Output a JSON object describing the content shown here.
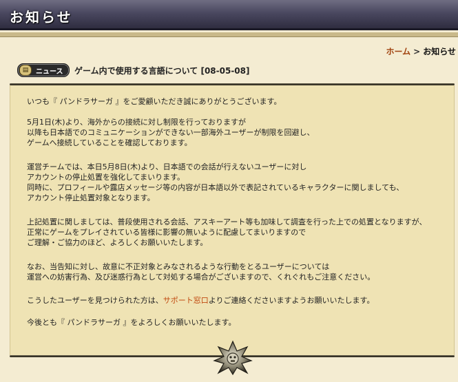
{
  "header": {
    "title": "お知らせ"
  },
  "breadcrumb": {
    "home": "ホーム",
    "separator": ">",
    "current": "お知らせ"
  },
  "news": {
    "badge": "ニュース",
    "title": "ゲーム内で使用する言語について [08-05-08]"
  },
  "body": {
    "p1": "いつも『 パンドラサーガ 』をご愛顧いただき誠にありがとうございます。",
    "p2": "5月1日(木)より、海外からの接続に対し制限を行っておりますが\n以降も日本語でのコミュニケーションができない一部海外ユーザーが制限を回避し、\nゲームへ接続していることを確認しております。",
    "p3": "運営チームでは、本日5月8日(木)より、日本語での会話が行えないユーザーに対し\nアカウントの停止処置を強化してまいります。\n同時に、プロフィールや露店メッセージ等の内容が日本語以外で表記されているキャラクターに関しましても、\nアカウント停止処置対象となります。",
    "p4": "上記処置に関しましては、普段使用される会話、アスキーアート等も加味して調査を行った上での処置となりますが、\n正常にゲームをプレイされている皆様に影響の無いように配慮してまいりますので\nご理解・ご協力のほど、よろしくお願いいたします。",
    "p5": "なお、当告知に対し、故意に不正対象とみなされるような行動をとるユーザーについては\n運営への妨害行為、及び迷惑行為として対処する場合がございますので、くれぐれもご注意ください。",
    "p6_before": "こうしたユーザーを見つけられた方は、",
    "p6_link": "サポート窓口",
    "p6_after": "よりご連絡くださいますようお願いいたします。",
    "p7": "今後とも『 パンドラサーガ 』をよろしくお願いいたします。"
  },
  "colors": {
    "link": "#c14a10",
    "home_link": "#a0420f",
    "content_bg": "#efe3b4",
    "page_bg": "#f4ecd2",
    "header_bg": "#4a4860"
  },
  "icons": {
    "badge_icon": "book-icon",
    "ornament": "cross-ornament-icon"
  }
}
